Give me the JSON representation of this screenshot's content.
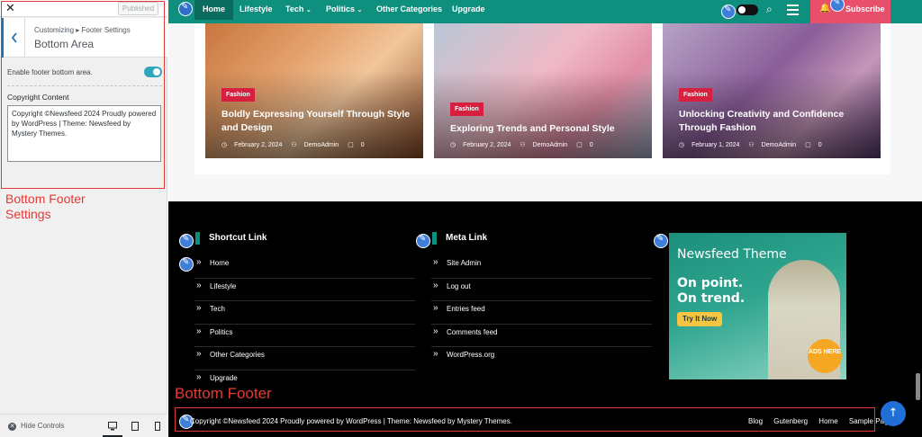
{
  "customizer": {
    "close_label": "✕",
    "published_label": "Published",
    "breadcrumb": "Customizing ▸ Footer Settings",
    "section_title": "Bottom Area",
    "enable_label": "Enable footer bottom area.",
    "enable_checked": true,
    "copyright_label": "Copyright Content",
    "copyright_value": "Copyright ©Newsfeed 2024 Proudly powered by WordPress | Theme: Newsfeed by Mystery Themes.",
    "annotation": "Bottom Footer Settings",
    "hide_controls": "Hide Controls",
    "accent_color": "#2271b1"
  },
  "nav": {
    "items": [
      "Home",
      "Lifestyle",
      "Tech",
      "Politics",
      "Other Categories",
      "Upgrade"
    ],
    "dropdown_items": [
      "Tech",
      "Politics"
    ],
    "subscribe_label": "Subscribe",
    "bar_color": "#0f8f7e",
    "subscribe_color": "#e84f6a"
  },
  "posts": [
    {
      "category": "Fashion",
      "title": "Boldly Expressing Yourself Through Style and Design",
      "date": "February 2, 2024",
      "author": "DemoAdmin",
      "comments": "0"
    },
    {
      "category": "Fashion",
      "title": "Exploring Trends and Personal Style",
      "date": "February 2, 2024",
      "author": "DemoAdmin",
      "comments": "0"
    },
    {
      "category": "Fashion",
      "title": "Unlocking Creativity and Confidence Through Fashion",
      "date": "February 1, 2024",
      "author": "DemoAdmin",
      "comments": "0"
    }
  ],
  "footer": {
    "shortcut": {
      "heading": "Shortcut Link",
      "links": [
        "Home",
        "Lifestyle",
        "Tech",
        "Politics",
        "Other Categories",
        "Upgrade"
      ]
    },
    "meta": {
      "heading": "Meta Link",
      "links": [
        "Site Admin",
        "Log out",
        "Entries feed",
        "Comments feed",
        "WordPress.org"
      ]
    },
    "ad": {
      "title": "Newsfeed Theme",
      "line1": "On point.",
      "line2": "On trend.",
      "cta": "Try It Now",
      "badge": "ADS HERE"
    },
    "annotation": "Bottom Footer",
    "copyright": "Copyright ©Newsfeed 2024 Proudly powered by WordPress | Theme: Newsfeed by Mystery Themes.",
    "bottom_links": [
      "Blog",
      "Gutenberg",
      "Home",
      "Sample Page"
    ]
  },
  "icons": {
    "back": "chevron-left-icon",
    "search": "search-icon",
    "menu": "hamburger-menu-icon",
    "bell": "bell-icon",
    "edit": "pencil-edit-icon",
    "scroll_top": "arrow-up-icon",
    "calendar": "calendar-icon",
    "user": "user-icon",
    "comment": "comment-icon"
  }
}
